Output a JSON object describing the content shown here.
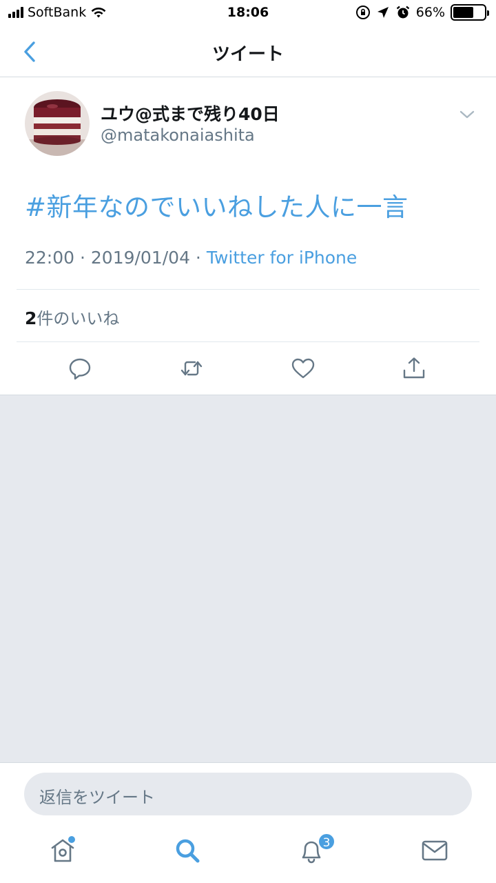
{
  "status_bar": {
    "carrier": "SoftBank",
    "time": "18:06",
    "battery": "66%",
    "battery_level": 0.66
  },
  "nav": {
    "title": "ツイート",
    "back_icon": "chevron-left-icon"
  },
  "tweet": {
    "display_name": "ユウ@式まで残り40日",
    "handle": "@matakonaiashita",
    "text": "#新年なのでいいねした人に一言",
    "time": "22:00",
    "separator1": " · ",
    "date": "2019/01/04",
    "separator2": " · ",
    "client": "Twitter for iPhone",
    "likes_count": "2",
    "likes_label": "件のいいね"
  },
  "actions": [
    "reply-icon",
    "retweet-icon",
    "like-icon",
    "share-icon"
  ],
  "reply": {
    "placeholder": "返信をツイート"
  },
  "tabbar": {
    "items": [
      "home-icon",
      "search-icon",
      "notifications-icon",
      "messages-icon"
    ],
    "notification_badge": "3"
  },
  "colors": {
    "accent": "#4a9fe0",
    "secondary_text": "#657786",
    "background_gray": "#e6e9ee"
  }
}
